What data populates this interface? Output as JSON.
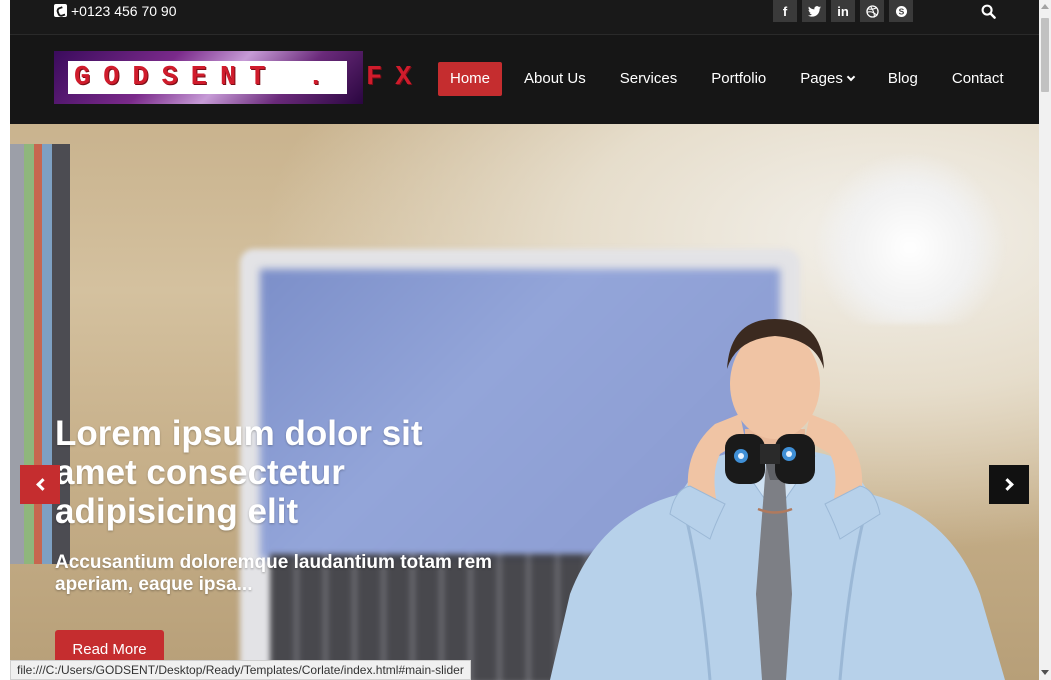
{
  "topbar": {
    "phone": "+0123 456 70 90",
    "social": [
      {
        "icon": "facebook-icon",
        "glyph": "f"
      },
      {
        "icon": "twitter-icon",
        "glyph": "t"
      },
      {
        "icon": "linkedin-icon",
        "glyph": "in"
      },
      {
        "icon": "dribbble-icon",
        "glyph": "⊛"
      },
      {
        "icon": "skype-icon",
        "glyph": "S"
      }
    ]
  },
  "header": {
    "logo_text": "GODSENT . FX",
    "nav": [
      {
        "label": "Home",
        "active": true
      },
      {
        "label": "About Us"
      },
      {
        "label": "Services"
      },
      {
        "label": "Portfolio"
      },
      {
        "label": "Pages",
        "dropdown": true
      },
      {
        "label": "Blog"
      },
      {
        "label": "Contact"
      }
    ]
  },
  "hero": {
    "title": "Lorem ipsum dolor sit amet consectetur adipisicing elit",
    "subtitle": "Accusantium doloremque laudantium totam rem aperiam, eaque ipsa...",
    "button": "Read More"
  },
  "statusbar": {
    "url": "file:///C:/Users/GODSENT/Desktop/Ready/Templates/Corlate/index.html#main-slider"
  },
  "colors": {
    "accent": "#c52d2f",
    "topbar": "#191919",
    "header": "#161616"
  }
}
